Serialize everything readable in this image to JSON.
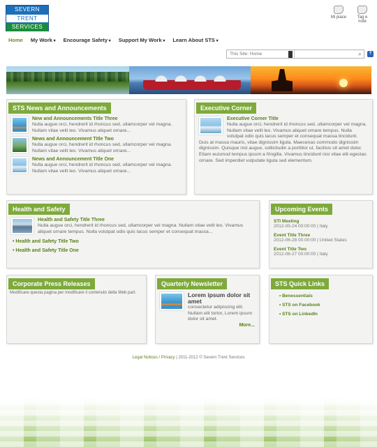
{
  "logo": {
    "line1": "SEVERN",
    "line2": "TRENT",
    "line3": "SERVICES"
  },
  "top_actions": [
    {
      "label": "Mi piace",
      "icon": "like-icon"
    },
    {
      "label": "Tag e note",
      "icon": "tag-icon"
    }
  ],
  "nav": {
    "home": "Home",
    "items": [
      "My Work",
      "Encourage Safety",
      "Support My Work",
      "Learn About STS"
    ]
  },
  "search": {
    "placeholder": "This Site: Home"
  },
  "news": {
    "title": "STS News and Announcements",
    "items": [
      {
        "title": "New and Announcements Title Three",
        "body": "Nulla augue orci, hendrerit id rhoncus sed, ullamcorper vel magna. Nullam vitae velit leo. Vivamus aliquet ornare..."
      },
      {
        "title": "News and Announcement Title Two",
        "body": "Nulla augue orci, hendrerit id rhoncus sed, ullamcorper vel magna. Nullam vitae velit leo. Vivamus aliquet ornare..."
      },
      {
        "title": "News and Announcement Title One",
        "body": "Nulla augue orci, hendrerit id rhoncus sed, ullamcorper vel magna. Nullam vitae velit leo. Vivamus aliquet ornare..."
      }
    ]
  },
  "exec": {
    "title": "Executive Corner",
    "item_title": "Executive Corner Title",
    "body": "Nulla augue orci, hendrerit id rhoncus sed, ullamcorper vel magna. Nullam vitae velit leo. Vivamus aliquet ornare tempus. Nulla volutpat odio quis lacus semper et consequat massa tincidunt. Duis at massa mauris, vitae dignissim ligula. Maecenas commodo dignissim dignissim. Quisque nisl augue, sollicitudin a porttitor ut, facilisis sit amet dolor. Etiam euismod tempus ipsum a fringilla. Vivamus tincidunt nisi vitae elit egestas ornare. Sed imperdiet vulputate ligula sed elementum."
  },
  "health": {
    "title": "Health and Safety",
    "item_title": "Health and Safety Title Three",
    "body": "Nulla augue orci, hendrerit id rhoncus sed, ullamcorper vel magna. Nullam vitae velit leo. Vivamus aliquet ornare tempus. Nulla volutpat odio quis lacus semper et consequat massa...",
    "links": [
      "Health and Safety Title Two",
      "Health and Safety Title One"
    ]
  },
  "events": {
    "title": "Upcoming Events",
    "items": [
      {
        "title": "STI Meeting",
        "date": "2012-05-24 00:00:00 | Italy"
      },
      {
        "title": "Event Title Three",
        "date": "2012-06-28 00:00:00 | United States"
      },
      {
        "title": "Event Title Two",
        "date": "2012-06-27 00:00:00 | Italy"
      }
    ]
  },
  "press": {
    "title": "Corporate Press Releases",
    "body": "Modificare questa pagina per modificare il contenuto della Web part."
  },
  "newsletter": {
    "title": "Quarterly Newsletter",
    "headline": "Lorem ipsum dolor sit amet",
    "lead": "consectetur adipiscing elit.",
    "body": "Nullam elit tortor, Lorem ipsum dolor sit amet.",
    "more": "More..."
  },
  "quicklinks": {
    "title": "STS Quick Links",
    "items": [
      "Benessentials",
      "STS on Facebook",
      "STS on LinkedIn"
    ]
  },
  "footer": {
    "link": "Legal Notices / Privacy",
    "text": " | 2011-2012 © Severn Trent Services"
  }
}
